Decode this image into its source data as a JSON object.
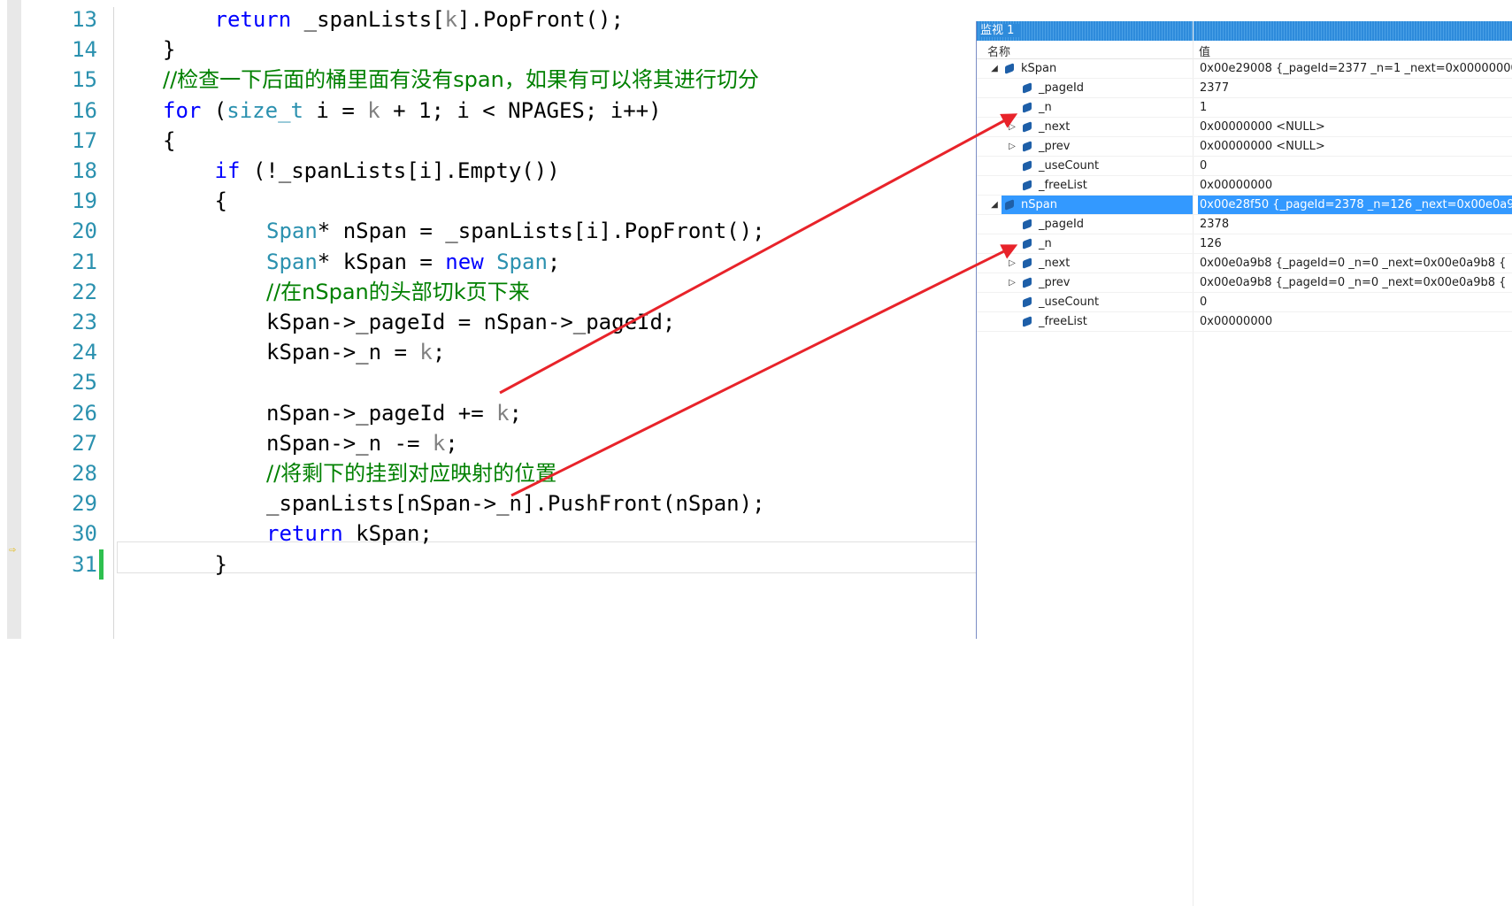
{
  "editor": {
    "lines": [
      {
        "number": "13",
        "indent": 2,
        "segments": [
          {
            "t": "return",
            "c": "kw"
          },
          {
            "t": " _spanLists[",
            "c": ""
          },
          {
            "t": "k",
            "c": "pm"
          },
          {
            "t": "].PopFront();",
            "c": ""
          }
        ]
      },
      {
        "number": "14",
        "indent": 1,
        "segments": [
          {
            "t": "}",
            "c": ""
          }
        ]
      },
      {
        "number": "15",
        "indent": 1,
        "comment": true,
        "segments": [
          {
            "t": "//检查一下后面的桶里面有没有span，如果有可以将其进行切分",
            "c": "cm"
          }
        ]
      },
      {
        "number": "16",
        "indent": 1,
        "segments": [
          {
            "t": "for",
            "c": "kw"
          },
          {
            "t": " (",
            "c": ""
          },
          {
            "t": "size_t",
            "c": "ty"
          },
          {
            "t": " i = ",
            "c": ""
          },
          {
            "t": "k",
            "c": "pm"
          },
          {
            "t": " + 1; i < NPAGES; i++)",
            "c": ""
          }
        ]
      },
      {
        "number": "17",
        "indent": 1,
        "segments": [
          {
            "t": "{",
            "c": ""
          }
        ]
      },
      {
        "number": "18",
        "indent": 2,
        "segments": [
          {
            "t": "if",
            "c": "kw"
          },
          {
            "t": " (!_spanLists[i].Empty())",
            "c": ""
          }
        ]
      },
      {
        "number": "19",
        "indent": 2,
        "segments": [
          {
            "t": "{",
            "c": ""
          }
        ]
      },
      {
        "number": "20",
        "indent": 3,
        "segments": [
          {
            "t": "Span",
            "c": "ty"
          },
          {
            "t": "* nSpan = _spanLists[i].PopFront();",
            "c": ""
          }
        ]
      },
      {
        "number": "21",
        "indent": 3,
        "segments": [
          {
            "t": "Span",
            "c": "ty"
          },
          {
            "t": "* kSpan = ",
            "c": ""
          },
          {
            "t": "new",
            "c": "kw"
          },
          {
            "t": " ",
            "c": ""
          },
          {
            "t": "Span",
            "c": "ty"
          },
          {
            "t": ";",
            "c": ""
          }
        ]
      },
      {
        "number": "22",
        "indent": 3,
        "comment": true,
        "segments": [
          {
            "t": "//在nSpan的头部切k页下来",
            "c": "cm"
          }
        ]
      },
      {
        "number": "23",
        "indent": 3,
        "segments": [
          {
            "t": "kSpan->_pageId = nSpan->_pageId;",
            "c": ""
          }
        ]
      },
      {
        "number": "24",
        "indent": 3,
        "segments": [
          {
            "t": "kSpan->_n = ",
            "c": ""
          },
          {
            "t": "k",
            "c": "pm"
          },
          {
            "t": ";",
            "c": ""
          }
        ]
      },
      {
        "number": "25",
        "indent": 0,
        "segments": []
      },
      {
        "number": "26",
        "indent": 3,
        "segments": [
          {
            "t": "nSpan->_pageId += ",
            "c": ""
          },
          {
            "t": "k",
            "c": "pm"
          },
          {
            "t": ";",
            "c": ""
          }
        ]
      },
      {
        "number": "27",
        "indent": 3,
        "segments": [
          {
            "t": "nSpan->_n -= ",
            "c": ""
          },
          {
            "t": "k",
            "c": "pm"
          },
          {
            "t": ";",
            "c": ""
          }
        ]
      },
      {
        "number": "28",
        "indent": 3,
        "comment": true,
        "segments": [
          {
            "t": "//将剩下的挂到对应映射的位置",
            "c": "cm"
          }
        ]
      },
      {
        "number": "29",
        "indent": 3,
        "segments": [
          {
            "t": "_spanLists[nSpan->_n].PushFront(nSpan);",
            "c": ""
          }
        ]
      },
      {
        "number": "30",
        "indent": 3,
        "segments": [
          {
            "t": "return",
            "c": "kw"
          },
          {
            "t": " kSpan;",
            "c": ""
          }
        ]
      },
      {
        "number": "31",
        "indent": 2,
        "changed": true,
        "segments": [
          {
            "t": "}",
            "c": ""
          }
        ]
      }
    ]
  },
  "watch": {
    "title": "监视 1",
    "col_name": "名称",
    "col_value": "值",
    "rows": [
      {
        "level": 0,
        "expander": "◢",
        "name": "kSpan",
        "value": "0x00e29008 {_pageId=2377 _n=1 _next=0x00000000",
        "selected": false
      },
      {
        "level": 1,
        "expander": "",
        "name": "_pageId",
        "value": "2377",
        "selected": false
      },
      {
        "level": 1,
        "expander": "",
        "name": "_n",
        "value": "1",
        "selected": false
      },
      {
        "level": 1,
        "expander": "▷",
        "name": "_next",
        "value": "0x00000000 <NULL>",
        "selected": false
      },
      {
        "level": 1,
        "expander": "▷",
        "name": "_prev",
        "value": "0x00000000 <NULL>",
        "selected": false
      },
      {
        "level": 1,
        "expander": "",
        "name": "_useCount",
        "value": "0",
        "selected": false
      },
      {
        "level": 1,
        "expander": "",
        "name": "_freeList",
        "value": "0x00000000",
        "selected": false
      },
      {
        "level": 0,
        "expander": "◢",
        "name": "nSpan",
        "value": "0x00e28f50 {_pageId=2378 _n=126 _next=0x00e0a9",
        "selected": true
      },
      {
        "level": 1,
        "expander": "",
        "name": "_pageId",
        "value": "2378",
        "selected": false
      },
      {
        "level": 1,
        "expander": "",
        "name": "_n",
        "value": "126",
        "selected": false
      },
      {
        "level": 1,
        "expander": "▷",
        "name": "_next",
        "value": "0x00e0a9b8 {_pageId=0 _n=0 _next=0x00e0a9b8 {",
        "selected": false
      },
      {
        "level": 1,
        "expander": "▷",
        "name": "_prev",
        "value": "0x00e0a9b8 {_pageId=0 _n=0 _next=0x00e0a9b8 {",
        "selected": false
      },
      {
        "level": 1,
        "expander": "",
        "name": "_useCount",
        "value": "0",
        "selected": false
      },
      {
        "level": 1,
        "expander": "",
        "name": "_freeList",
        "value": "0x00000000",
        "selected": false
      }
    ]
  },
  "annotations": {
    "arrow_color": "#e8232a"
  }
}
